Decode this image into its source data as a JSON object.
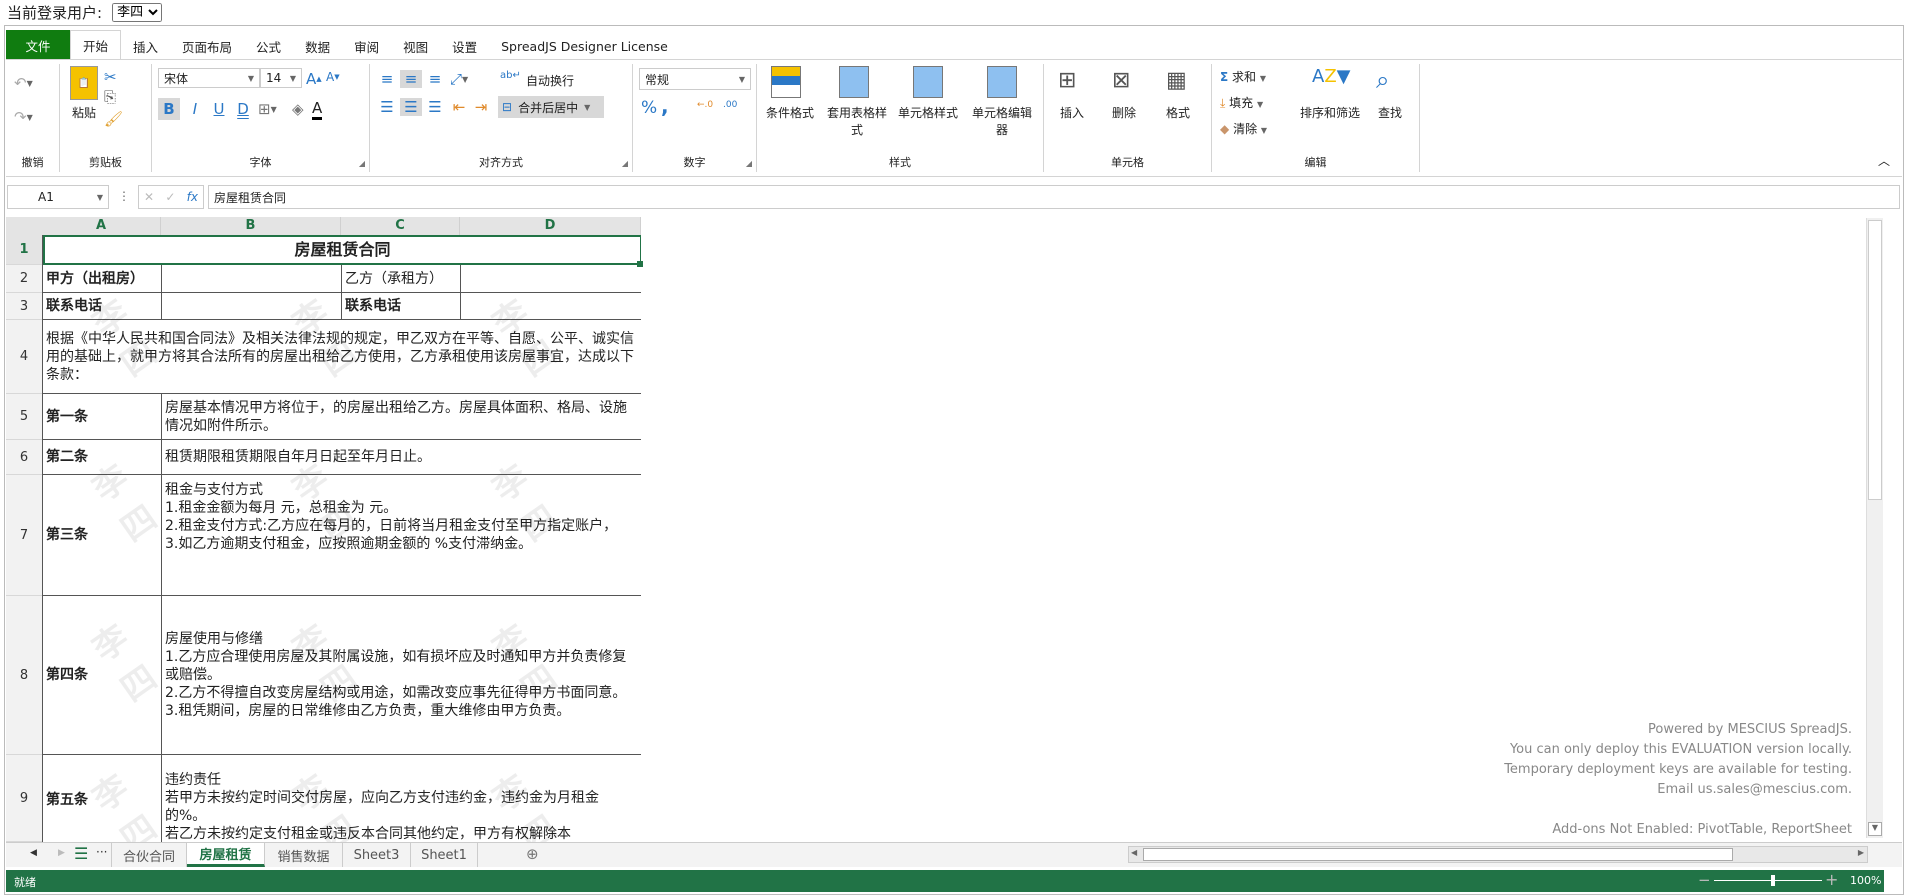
{
  "user_bar": {
    "label": "当前登录用户:",
    "selected_user": "李四"
  },
  "ribbon_tabs": [
    "文件",
    "开始",
    "插入",
    "页面布局",
    "公式",
    "数据",
    "审阅",
    "视图",
    "设置",
    "SpreadJS Designer License"
  ],
  "ribbon": {
    "undo_group": "撤销",
    "clipboard": {
      "label": "剪贴板",
      "paste": "粘贴"
    },
    "font": {
      "label": "字体",
      "family": "宋体",
      "size": "14",
      "bold": "B",
      "italic": "I",
      "underline": "U",
      "double_underline": "D"
    },
    "alignment": {
      "label": "对齐方式",
      "wrap": "自动换行",
      "merge": "合并后居中"
    },
    "number": {
      "label": "数字",
      "format": "常规",
      "percent": "%",
      "comma": ","
    },
    "styles": {
      "label": "样式",
      "cond": "条件格式",
      "table": "套用表格样式",
      "cell_style": "单元格样式",
      "cell_editor": "单元格编辑器"
    },
    "cells": {
      "label": "单元格",
      "insert": "插入",
      "delete": "删除",
      "format": "格式"
    },
    "editing": {
      "label": "编辑",
      "sum": "求和",
      "fill": "填充",
      "clear": "清除",
      "sort": "排序和筛选",
      "find": "查找"
    }
  },
  "formula_bar": {
    "name_box": "A1",
    "fx": "fx",
    "value": "房屋租赁合同"
  },
  "sheet": {
    "columns": [
      "A",
      "B",
      "C",
      "D"
    ],
    "rows": [
      "1",
      "2",
      "3",
      "4",
      "5",
      "6",
      "7",
      "8",
      "9"
    ],
    "cells": {
      "title": "房屋租赁合同",
      "a2": "甲方（出租房）",
      "c2": "乙方（承租方）",
      "a3": "联系电话",
      "c3": "联系电话",
      "a4": "根据《中华人民共和国合同法》及相关法律法规的规定，甲乙双方在平等、自愿、公平、诚实信用的基础上，就甲方将其合法所有的房屋出租给乙方使用，乙方承租使用该房屋事宜，达成以下条款：",
      "a5": "第一条",
      "b5": "房屋基本情况甲方将位于，的房屋出租给乙方。房屋具体面积、格局、设施情况如附件所示。",
      "a6": "第二条",
      "b6": "租赁期限租赁期限自年月日起至年月日止。",
      "a7": "第三条",
      "b7": "租金与支付方式\n1.租金金额为每月 元，总租金为 元。\n2.租金支付方式:乙方应在每月的，日前将当月租金支付至甲方指定账户，\n3.如乙方逾期支付租金，应按照逾期金额的 %支付滞纳金。",
      "a8": "第四条",
      "b8": "房屋使用与修缮\n1.乙方应合理使用房屋及其附属设施，如有损坏应及时通知甲方并负责修复或赔偿。\n2.乙方不得擅自改变房屋结构或用途，如需改变应事先征得甲方书面同意。\n3.租凭期间，房屋的日常维修由乙方负责，重大维修由甲方负责。",
      "a9": "第五条",
      "b9": "违约责任\n若甲方未按约定时间交付房屋，应向乙方支付违约金，违约金为月租金的%。\n若乙方未按约定支付租金或违反本合同其他约定，甲方有权解除本"
    },
    "watermark": "李四"
  },
  "sheet_tabs": [
    "合伙合同",
    "房屋租赁",
    "销售数据",
    "Sheet3",
    "Sheet1"
  ],
  "active_sheet": "房屋租赁",
  "notice": [
    "Powered by MESCIUS SpreadJS.",
    "You can only deploy this EVALUATION version locally.",
    "Temporary deployment keys are available for testing.",
    "Email us.sales@mescius.com.",
    "Add-ons Not Enabled: PivotTable, ReportSheet"
  ],
  "status": {
    "text": "就绪",
    "zoom": "100%",
    "zoom_value": 100
  }
}
